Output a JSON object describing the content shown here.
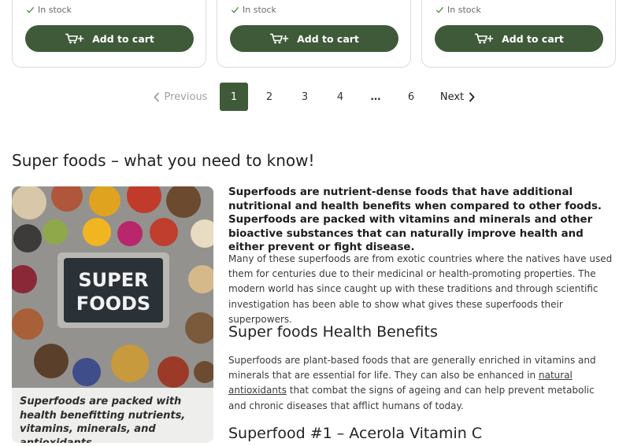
{
  "products": [
    {
      "stock": "In stock",
      "button": "Add to cart"
    },
    {
      "stock": "In stock",
      "button": "Add to cart"
    },
    {
      "stock": "In stock",
      "button": "Add to cart"
    }
  ],
  "pagination": {
    "previous": "Previous",
    "pages": [
      "1",
      "2",
      "3",
      "4",
      "…",
      "6"
    ],
    "current": "1",
    "next": "Next"
  },
  "article": {
    "title": "Super foods – what you need to know!",
    "image_sign": [
      "SUPER",
      "FOODS"
    ],
    "caption": "Superfoods are packed with health benefitting nutrients, vitamins, minerals, and antioxidants.",
    "lead": "Superfoods are nutrient-dense foods that have additional nutritional and health benefits when compared to other foods. Superfoods are packed with vitamins and minerals and other bioactive substances that can naturally improve health and either prevent or fight disease.",
    "paragraph1": "Many of these superfoods are from exotic countries where the natives have used them for centuries due to their medicinal or health-promoting properties. The modern world has since caught up with these traditions and through scientific investigation has been able to show what gives these superfoods their superpowers.",
    "heading_benefits": "Super foods Health Benefits",
    "paragraph2_before": "Superfoods are plant-based foods that are generally enriched in vitamins and minerals that are essential for life. They can also be enhanced in ",
    "paragraph2_link": "natural antioxidants",
    "paragraph2_after": " that combat the signs of ageing and can help prevent metabolic and chronic diseases that afflict humans of today.",
    "heading_acerola": "Superfood #1 – Acerola Vitamin C"
  },
  "colors": {
    "accent": "#3e5a38",
    "stock_check": "#4b8a3b"
  },
  "icons": {
    "stock": "check-icon",
    "cart": "cart-plus-icon",
    "prev": "chevron-left-icon",
    "next": "chevron-right-icon"
  }
}
